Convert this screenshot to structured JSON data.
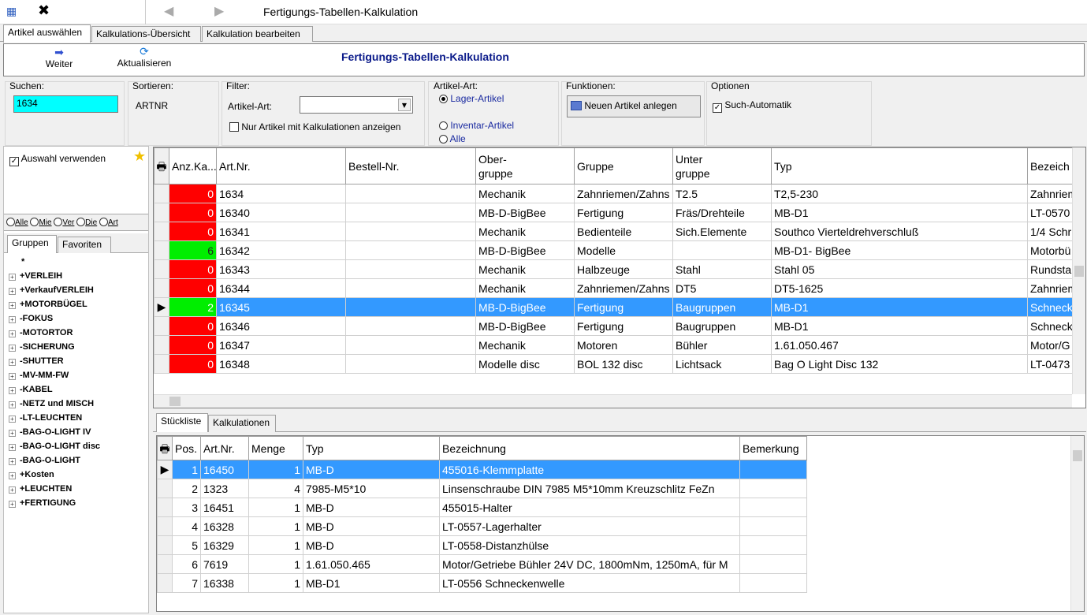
{
  "app": {
    "title": "Fertigungs-Tabellen-Kalkulation"
  },
  "tabs": [
    "Artikel auswählen",
    "Kalkulations-Übersicht",
    "Kalkulation bearbeiten"
  ],
  "toolbar": {
    "weiter": "Weiter",
    "aktualisieren": "Aktualisieren",
    "heading": "Fertigungs-Tabellen-Kalkulation"
  },
  "search": {
    "label": "Suchen:",
    "value": "1634"
  },
  "sort": {
    "label": "Sortieren:",
    "value": "ARTNR"
  },
  "filter": {
    "label": "Filter:",
    "art_label": "Artikel-Art:",
    "art_value": "",
    "only_calc": "Nur Artikel mit Kalkulationen anzeigen"
  },
  "artikel_art": {
    "label": "Artikel-Art:",
    "options": [
      "Lager-Artikel",
      "Inventar-Artikel",
      "Alle"
    ],
    "selected": "Lager-Artikel"
  },
  "funktionen": {
    "label": "Funktionen:",
    "new_button": "Neuen Artikel anlegen"
  },
  "optionen": {
    "label": "Optionen",
    "such_automatik": "Such-Automatik"
  },
  "left": {
    "auswahl": "Auswahl verwenden",
    "radios": [
      "Alle",
      "Mie",
      "Ver",
      "Die",
      "Art"
    ],
    "tabs": [
      "Gruppen",
      "Favoriten"
    ],
    "tree": [
      "*",
      "+VERLEIH",
      "+VerkaufVERLEIH",
      "+MOTORBÜGEL",
      "-FOKUS",
      "-MOTORTOR",
      "-SICHERUNG",
      "-SHUTTER",
      "-MV-MM-FW",
      "-KABEL",
      "-NETZ und MISCH",
      "-LT-LEUCHTEN",
      "-BAG-O-LIGHT IV",
      "-BAG-O-LIGHT disc",
      "-BAG-O-LIGHT",
      "+Kosten",
      "+LEUCHTEN",
      "+FERTIGUNG"
    ]
  },
  "main_grid": {
    "headers": [
      "Anz.Ka...",
      "Art.Nr.",
      "Bestell-Nr.",
      "Ober-\ngruppe",
      "Gruppe",
      "Unter\ngruppe",
      "Typ",
      "Bezeich"
    ],
    "rows": [
      {
        "anz": "0",
        "c": "red",
        "artnr": "1634",
        "bestell": "",
        "ober": "Mechanik",
        "gruppe": "Zahnriemen/Zahns",
        "unter": "T2.5",
        "typ": "T2,5-230",
        "bez": "Zahnriem"
      },
      {
        "anz": "0",
        "c": "red",
        "artnr": "16340",
        "bestell": "",
        "ober": "MB-D-BigBee",
        "gruppe": "Fertigung",
        "unter": "Fräs/Drehteile",
        "typ": "MB-D1",
        "bez": "LT-0570"
      },
      {
        "anz": "0",
        "c": "red",
        "artnr": "16341",
        "bestell": "",
        "ober": "Mechanik",
        "gruppe": "Bedienteile",
        "unter": "Sich.Elemente",
        "typ": "Southco Vierteldrehverschluß",
        "bez": "1/4 Schr"
      },
      {
        "anz": "6",
        "c": "grn",
        "artnr": "16342",
        "bestell": "",
        "ober": "MB-D-BigBee",
        "gruppe": "Modelle",
        "unter": "",
        "typ": "MB-D1- BigBee",
        "bez": "Motorbü"
      },
      {
        "anz": "0",
        "c": "red",
        "artnr": "16343",
        "bestell": "",
        "ober": "Mechanik",
        "gruppe": "Halbzeuge",
        "unter": "Stahl",
        "typ": "Stahl 05",
        "bez": "Rundsta"
      },
      {
        "anz": "0",
        "c": "red",
        "artnr": "16344",
        "bestell": "",
        "ober": "Mechanik",
        "gruppe": "Zahnriemen/Zahns",
        "unter": "DT5",
        "typ": "DT5-1625",
        "bez": "Zahnriem"
      },
      {
        "anz": "2",
        "c": "grn",
        "artnr": "16345",
        "bestell": "",
        "ober": "MB-D-BigBee",
        "gruppe": "Fertigung",
        "unter": "Baugruppen",
        "typ": "MB-D1",
        "bez": "Schneck",
        "sel": true
      },
      {
        "anz": "0",
        "c": "red",
        "artnr": "16346",
        "bestell": "",
        "ober": "MB-D-BigBee",
        "gruppe": "Fertigung",
        "unter": "Baugruppen",
        "typ": "MB-D1",
        "bez": "Schneck"
      },
      {
        "anz": "0",
        "c": "red",
        "artnr": "16347",
        "bestell": "",
        "ober": "Mechanik",
        "gruppe": "Motoren",
        "unter": "Bühler",
        "typ": "1.61.050.467",
        "bez": "Motor/G"
      },
      {
        "anz": "0",
        "c": "red",
        "artnr": "16348",
        "bestell": "",
        "ober": "Modelle disc",
        "gruppe": "BOL 132 disc",
        "unter": "Lichtsack",
        "typ": "Bag O Light Disc 132",
        "bez": "LT-0473"
      }
    ]
  },
  "bottom_tabs": [
    "Stückliste",
    "Kalkulationen"
  ],
  "bom": {
    "headers": [
      "Pos.",
      "Art.Nr.",
      "Menge",
      "Typ",
      "Bezeichnung",
      "Bemerkung"
    ],
    "rows": [
      {
        "pos": "1",
        "artnr": "16450",
        "menge": "1",
        "typ": "MB-D",
        "bez": "455016-Klemmplatte",
        "bem": "",
        "sel": true
      },
      {
        "pos": "2",
        "artnr": "1323",
        "menge": "4",
        "typ": "7985-M5*10",
        "bez": "Linsenschraube DIN 7985 M5*10mm Kreuzschlitz FeZn",
        "bem": ""
      },
      {
        "pos": "3",
        "artnr": "16451",
        "menge": "1",
        "typ": "MB-D",
        "bez": "455015-Halter",
        "bem": ""
      },
      {
        "pos": "4",
        "artnr": "16328",
        "menge": "1",
        "typ": "MB-D",
        "bez": "LT-0557-Lagerhalter",
        "bem": ""
      },
      {
        "pos": "5",
        "artnr": "16329",
        "menge": "1",
        "typ": "MB-D",
        "bez": "LT-0558-Distanzhülse",
        "bem": ""
      },
      {
        "pos": "6",
        "artnr": "7619",
        "menge": "1",
        "typ": "1.61.050.465",
        "bez": "Motor/Getriebe Bühler 24V DC, 1800mNm, 1250mA, für M",
        "bem": ""
      },
      {
        "pos": "7",
        "artnr": "16338",
        "menge": "1",
        "typ": "MB-D1",
        "bez": "LT-0556 Schneckenwelle",
        "bem": ""
      }
    ]
  },
  "colors": {
    "selection": "#3399ff",
    "zero": "#ff0000",
    "positive": "#00ee00",
    "search_bg": "#00ffff",
    "heading": "#0a1a8a"
  }
}
